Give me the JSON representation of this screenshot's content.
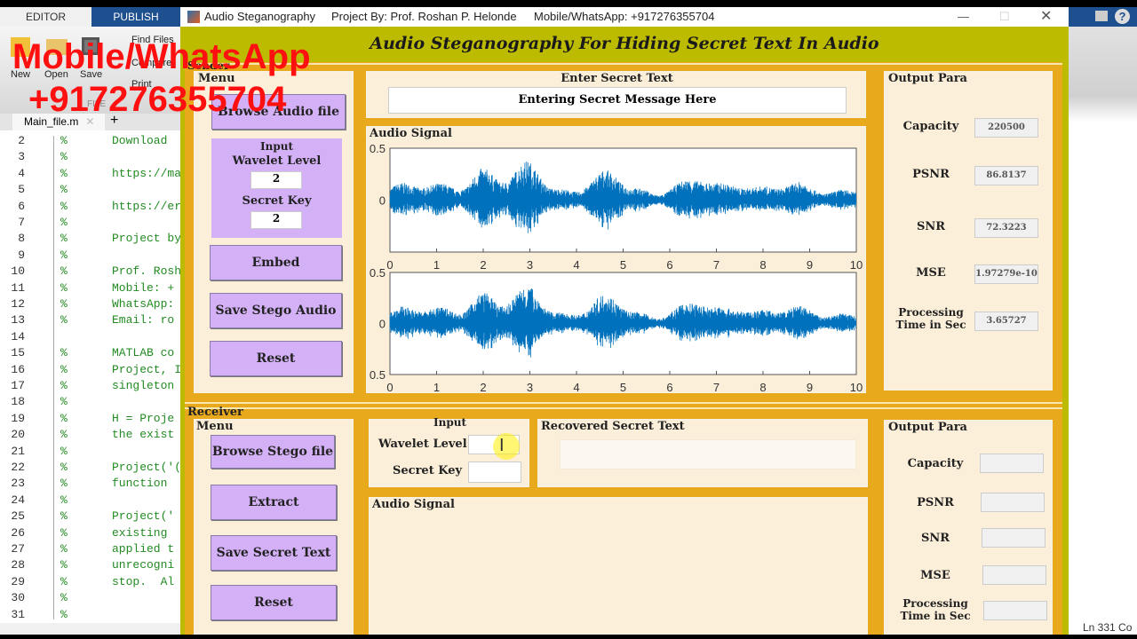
{
  "editor": {
    "tabs": [
      "EDITOR",
      "PUBLISH"
    ],
    "toolbar": {
      "new": "New",
      "open": "Open",
      "save": "Save",
      "find_files": "Find Files",
      "compare": "Compare",
      "print": "Print",
      "section": "FILE"
    },
    "file_tab": "Main_file.m",
    "lines": [
      {
        "n": "2",
        "t": "Download"
      },
      {
        "n": "3",
        "t": ""
      },
      {
        "n": "4",
        "t": "https://ma"
      },
      {
        "n": "5",
        "t": ""
      },
      {
        "n": "6",
        "t": "https://er"
      },
      {
        "n": "7",
        "t": ""
      },
      {
        "n": "8",
        "t": "Project by"
      },
      {
        "n": "9",
        "t": ""
      },
      {
        "n": "10",
        "t": "Prof. Rosh"
      },
      {
        "n": "11",
        "t": "Mobile: +"
      },
      {
        "n": "12",
        "t": "WhatsApp:"
      },
      {
        "n": "13",
        "t": "Email: ro"
      },
      {
        "n": "14",
        "t": "",
        "nopct": true
      },
      {
        "n": "15",
        "t": "MATLAB co"
      },
      {
        "n": "16",
        "t": "Project, I"
      },
      {
        "n": "17",
        "t": "singleton"
      },
      {
        "n": "18",
        "t": ""
      },
      {
        "n": "19",
        "t": "H = Proje"
      },
      {
        "n": "20",
        "t": "the exist"
      },
      {
        "n": "21",
        "t": ""
      },
      {
        "n": "22",
        "t": "Project('("
      },
      {
        "n": "23",
        "t": "function "
      },
      {
        "n": "24",
        "t": ""
      },
      {
        "n": "25",
        "t": "Project('"
      },
      {
        "n": "26",
        "t": "existing "
      },
      {
        "n": "27",
        "t": "applied t"
      },
      {
        "n": "28",
        "t": "unrecogni"
      },
      {
        "n": "29",
        "t": "stop.  Al"
      },
      {
        "n": "30",
        "t": ""
      },
      {
        "n": "31",
        "t": ""
      }
    ],
    "status": "Ln  331  Co"
  },
  "watermark": {
    "line1": "Mobile/WhatsApp",
    "line2": "+917276355704"
  },
  "window": {
    "title": "Audio Steganography",
    "project": "Project By: Prof. Roshan P. Helonde",
    "mobile": "Mobile/WhatsApp: +917276355704"
  },
  "main_title": "Audio Steganography For Hiding Secret Text In Audio",
  "sender": {
    "label": "Sender",
    "menu": "Menu",
    "browse": "Browse Audio file",
    "input": "Input",
    "wavelet_label": "Wavelet Level",
    "wavelet_value": "2",
    "key_label": "Secret Key",
    "key_value": "2",
    "embed": "Embed",
    "save": "Save Stego Audio",
    "reset": "Reset",
    "secret_title": "Enter Secret Text",
    "secret_value": "Entering Secret Message Here",
    "signal_title": "Audio Signal",
    "output_title": "Output Para",
    "outputs": [
      {
        "label": "Capacity",
        "value": "220500"
      },
      {
        "label": "PSNR",
        "value": "86.8137"
      },
      {
        "label": "SNR",
        "value": "72.3223"
      },
      {
        "label": "MSE",
        "value": "1.97279e-10"
      },
      {
        "label": "Processing Time in Sec",
        "value": "3.65727"
      }
    ]
  },
  "receiver": {
    "label": "Receiver",
    "menu": "Menu",
    "browse": "Browse Stego file",
    "extract": "Extract",
    "save": "Save Secret Text",
    "reset": "Reset",
    "input": "Input",
    "wavelet_label": "Wavelet Level",
    "key_label": "Secret Key",
    "recovered_title": "Recovered Secret Text",
    "signal_title": "Audio Signal",
    "output_title": "Output Para",
    "outputs": [
      {
        "label": "Capacity"
      },
      {
        "label": "PSNR"
      },
      {
        "label": "SNR"
      },
      {
        "label": "MSE"
      },
      {
        "label": "Processing Time in Sec"
      }
    ]
  },
  "chart_data": [
    {
      "type": "line",
      "title": "",
      "xlim": [
        0,
        10
      ],
      "ylim": [
        -0.5,
        0.5
      ],
      "xticks": [
        "0",
        "1",
        "2",
        "3",
        "4",
        "5",
        "6",
        "7",
        "8",
        "9",
        "10"
      ],
      "yticks": [
        "0.5",
        "0",
        "0.5"
      ],
      "color": "#0072bd"
    },
    {
      "type": "line",
      "title": "",
      "xlim": [
        0,
        10
      ],
      "ylim": [
        -0.5,
        0.5
      ],
      "xticks": [
        "0",
        "1",
        "2",
        "3",
        "4",
        "5",
        "6",
        "7",
        "8",
        "9",
        "10"
      ],
      "yticks": [
        "0.5",
        "0",
        "0.5"
      ],
      "color": "#0072bd"
    }
  ]
}
